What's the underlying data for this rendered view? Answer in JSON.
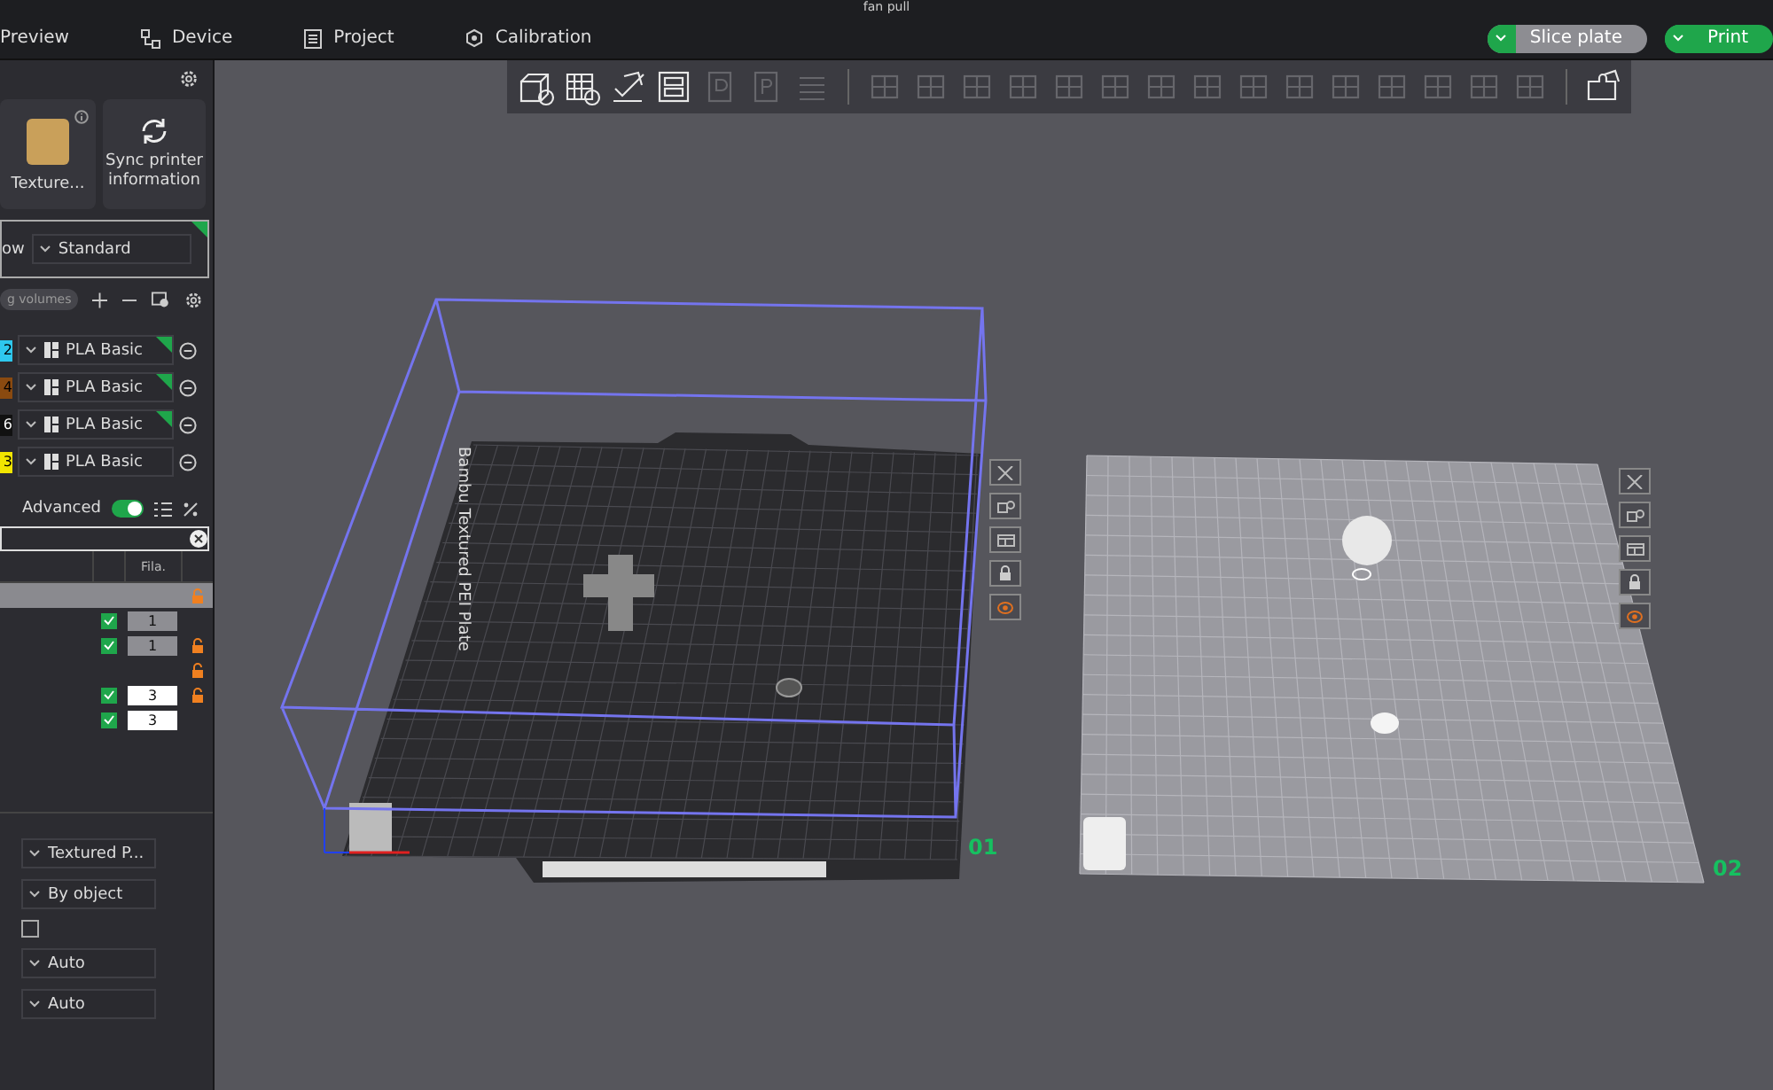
{
  "title": "fan pull",
  "menu": [
    {
      "label": "Preview",
      "kind": "none"
    },
    {
      "label": "Device",
      "kind": "device"
    },
    {
      "label": "Project",
      "kind": "project"
    },
    {
      "label": "Calibration",
      "kind": "calibration"
    }
  ],
  "actions": [
    {
      "label": "Slice plate",
      "selected": true
    },
    {
      "label": "Print",
      "selected": false
    }
  ],
  "toolbar": [
    [
      {
        "disabled": false
      },
      {
        "disabled": false
      },
      {
        "disabled": false
      },
      {
        "disabled": false
      },
      {
        "disabled": true
      },
      {
        "disabled": true
      },
      {
        "disabled": true
      }
    ],
    [
      {
        "disabled": true
      },
      {
        "disabled": true
      },
      {
        "disabled": true
      },
      {
        "disabled": true
      },
      {
        "disabled": true
      },
      {
        "disabled": true
      },
      {
        "disabled": true
      },
      {
        "disabled": true
      },
      {
        "disabled": true
      },
      {
        "disabled": true
      },
      {
        "disabled": true
      },
      {
        "disabled": true
      },
      {
        "disabled": true
      },
      {
        "disabled": true
      },
      {
        "disabled": true
      }
    ],
    [
      {
        "disabled": false
      }
    ]
  ],
  "printer": {
    "plate_label": "Texture...",
    "sync_label": "Sync printer information"
  },
  "process": {
    "label": "ow",
    "preset": "Standard",
    "synced": true
  },
  "filament_bar": {
    "chip": "g volumes"
  },
  "filaments": [
    {
      "number": "2",
      "color": "#2ec8ee",
      "name": "PLA Basic",
      "synced": true
    },
    {
      "number": "4",
      "color": "#8a4a10",
      "name": "PLA Basic",
      "synced": true
    },
    {
      "number": "6",
      "color": "#111111",
      "name": "PLA Basic",
      "synced": true
    },
    {
      "number": "3",
      "color": "#f2e600",
      "name": "PLA Basic",
      "synced": false
    }
  ],
  "objects": {
    "advanced_label": "Advanced",
    "advanced": true,
    "column": "Fila.",
    "rows": [
      {
        "kind": "group",
        "selected": true,
        "lock": true
      },
      {
        "kind": "item",
        "selected": false,
        "checked": true,
        "filament": "1",
        "editable": false,
        "lock": false
      },
      {
        "kind": "item",
        "selected": false,
        "checked": true,
        "filament": "1",
        "editable": false,
        "lock": true
      },
      {
        "kind": "group",
        "selected": false,
        "lock": true
      },
      {
        "kind": "item",
        "selected": false,
        "checked": true,
        "filament": "3",
        "editable": true,
        "lock": true
      },
      {
        "kind": "item",
        "selected": false,
        "checked": true,
        "filament": "3",
        "editable": true,
        "lock": false
      }
    ]
  },
  "settings": [
    {
      "kind": "dropdown",
      "value": "Textured P..."
    },
    {
      "kind": "dropdown",
      "value": "By object"
    },
    {
      "kind": "checkbox",
      "checked": false
    },
    {
      "kind": "dropdown",
      "value": "Auto"
    },
    {
      "kind": "dropdown",
      "value": "Auto"
    }
  ],
  "plates": [
    {
      "kind": "dark",
      "label": "01",
      "name": "Bambu Textured PEI Plate"
    },
    {
      "kind": "light",
      "label": "02"
    }
  ]
}
